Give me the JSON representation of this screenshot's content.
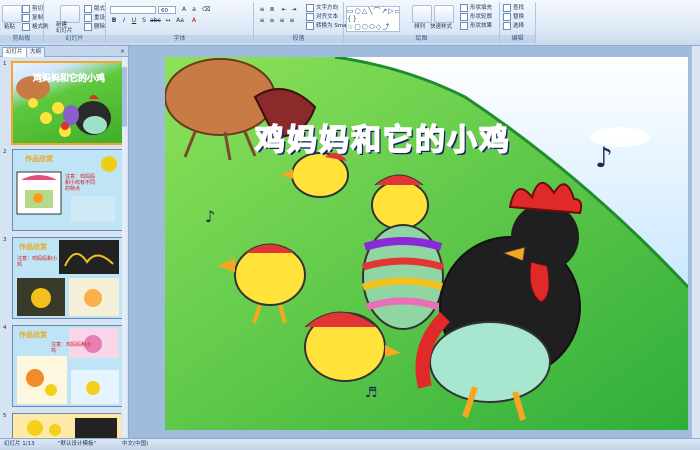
{
  "ribbon": {
    "groups": [
      {
        "name": "clipboard",
        "label": "剪贴板"
      },
      {
        "name": "slides",
        "label": "幻灯片"
      },
      {
        "name": "font",
        "label": "字体"
      },
      {
        "name": "paragraph",
        "label": "段落"
      },
      {
        "name": "drawing",
        "label": "绘图"
      },
      {
        "name": "editing",
        "label": "编辑"
      }
    ],
    "clipboard": {
      "paste": "粘贴",
      "cut": "剪切",
      "copy": "复制",
      "format_painter": "格式刷"
    },
    "slides": {
      "new_slide": "新建\n幻灯片",
      "layout": "版式",
      "reset": "重设",
      "delete": "删除"
    },
    "font": {
      "font_name": "",
      "font_size": "60"
    },
    "paragraph": {
      "text_direction": "文字方向",
      "align_text": "对齐文本",
      "smartart": "转换为 SmartArt"
    },
    "drawing": {
      "arrange": "排列",
      "quick_styles": "快速样式",
      "shape_fill": "形状填充",
      "shape_outline": "形状轮廓",
      "shape_effects": "形状效果"
    },
    "editing": {
      "find": "查找",
      "replace": "替换",
      "select": "选择"
    }
  },
  "left_panel": {
    "tabs": [
      {
        "label": "幻灯片"
      },
      {
        "label": "大纲"
      }
    ],
    "close": "×",
    "slides": [
      {
        "number": "1",
        "title": "鸡妈妈和它的小鸡"
      },
      {
        "number": "2",
        "title": "作品欣赏",
        "caption": "注意：鸡妈妈和小鸡有不同的特点"
      },
      {
        "number": "3",
        "title": "作品欣赏",
        "caption": "注意：鸡妈妈和小鸡"
      },
      {
        "number": "4",
        "title": "作品欣赏",
        "caption": "注意：鸡妈妈和小鸡"
      },
      {
        "number": "5",
        "title": ""
      }
    ]
  },
  "slide": {
    "title": "鸡妈妈和它的小鸡"
  },
  "statusbar": {
    "slide_info": "幻灯片 1/13",
    "theme": "\"默认设计模板\"",
    "language": "中文(中国)"
  },
  "colors": {
    "title_blue": "#2f4fd6",
    "ribbon_bg": "#dbe7f5",
    "window_bg": "#9fbcdc",
    "selection": "#f5a623"
  }
}
